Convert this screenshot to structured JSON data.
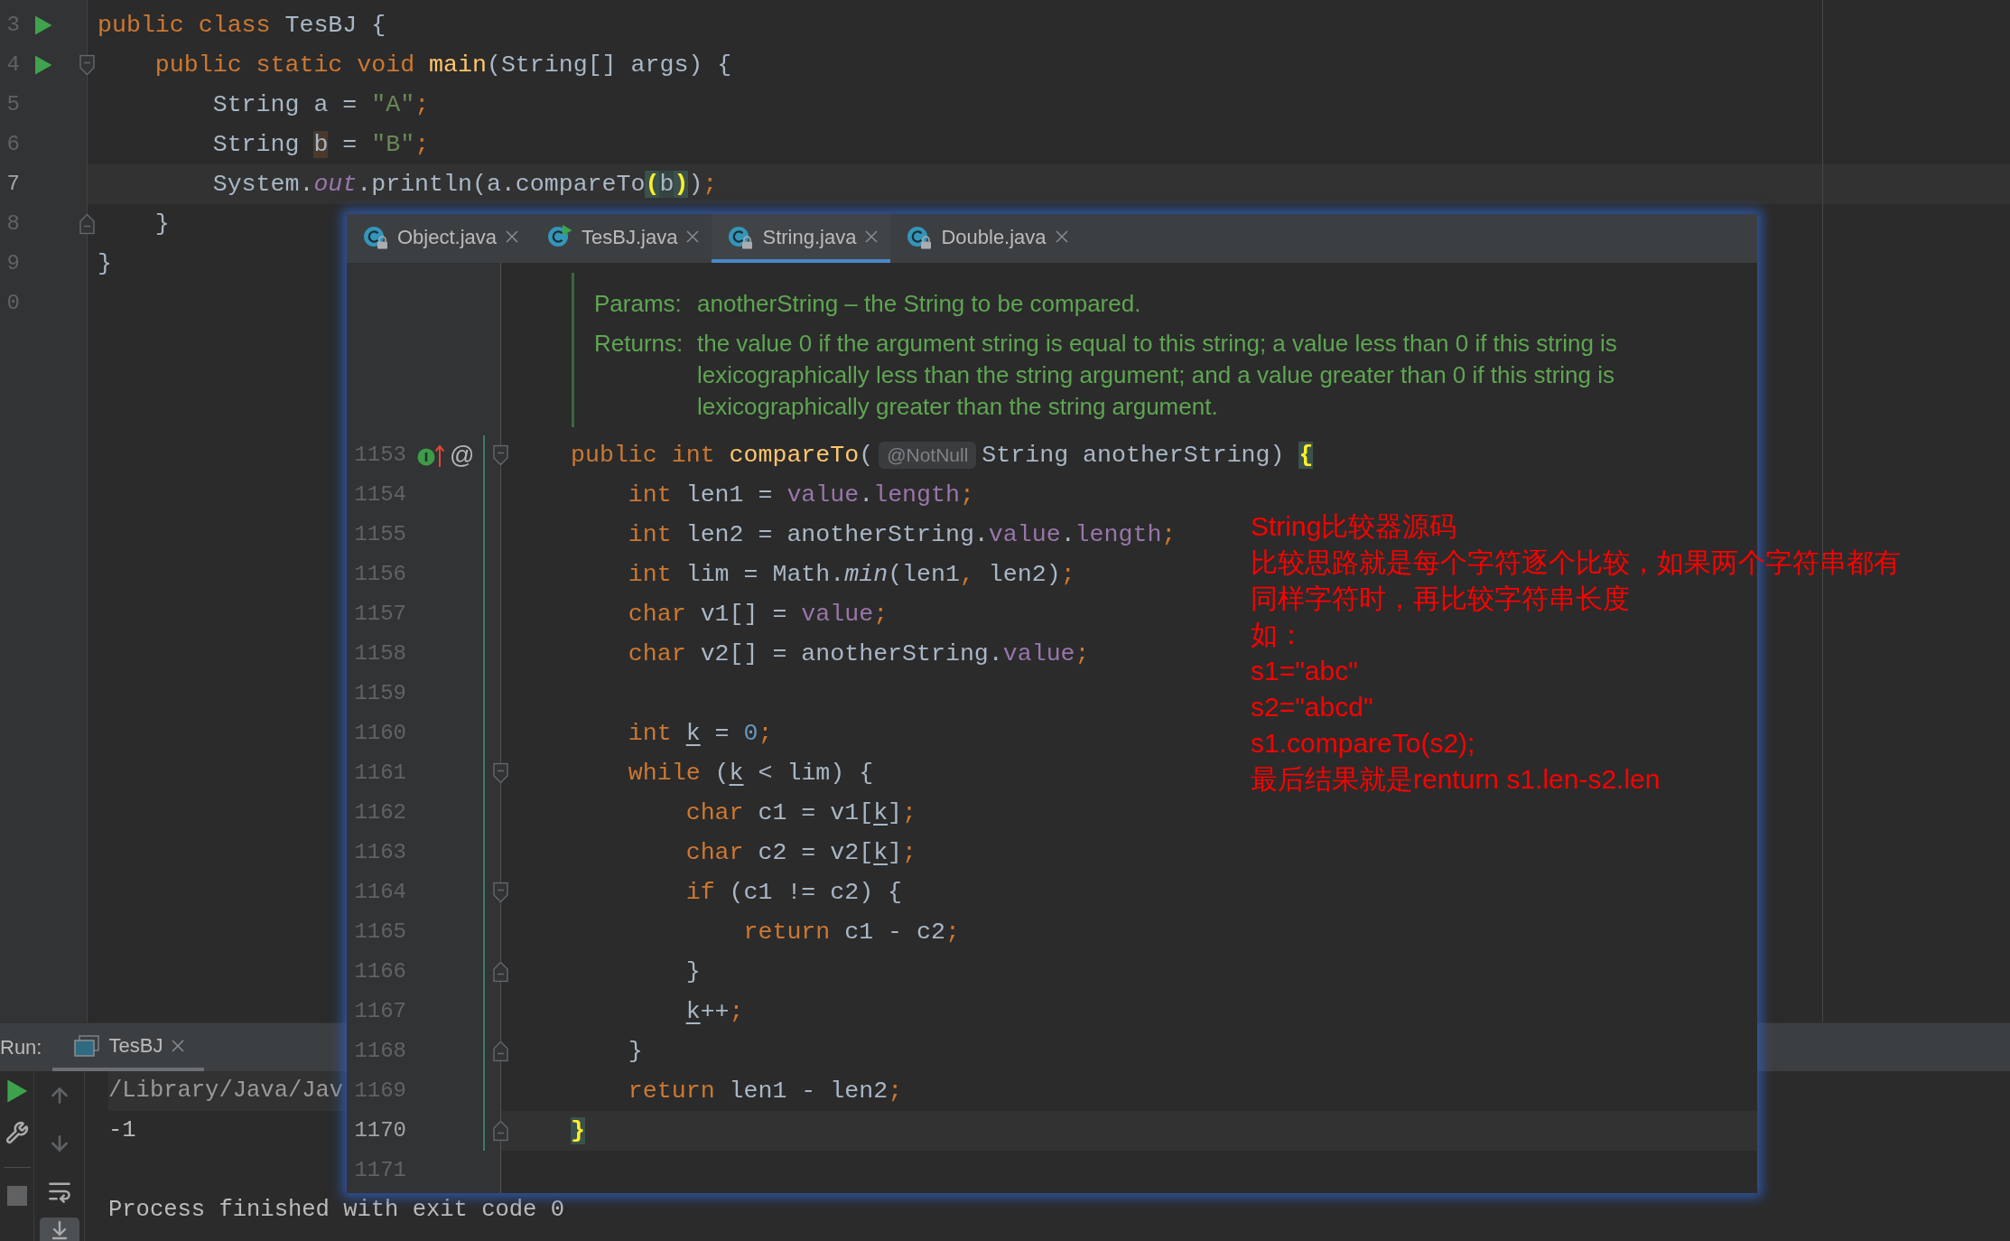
{
  "editor": {
    "lines": [
      {
        "number": "3",
        "run_marker": true,
        "current": false,
        "fold_start": false,
        "fold_end": false,
        "tokens": [
          {
            "text": "public ",
            "kind": "keyword"
          },
          {
            "text": "class ",
            "kind": "keyword"
          },
          {
            "text": "TesBJ {",
            "kind": "plain"
          }
        ]
      },
      {
        "number": "4",
        "run_marker": true,
        "current": false,
        "fold_start": true,
        "fold_end": false,
        "tokens": [
          {
            "text": "    public ",
            "kind": "keyword"
          },
          {
            "text": "static ",
            "kind": "keyword"
          },
          {
            "text": "void ",
            "kind": "keyword"
          },
          {
            "text": "main",
            "kind": "method_decl"
          },
          {
            "text": "(String[] args) {",
            "kind": "plain"
          }
        ]
      },
      {
        "number": "5",
        "run_marker": false,
        "current": false,
        "fold_start": false,
        "fold_end": false,
        "tokens": [
          {
            "text": "        String a = ",
            "kind": "plain"
          },
          {
            "text": "\"A\"",
            "kind": "string"
          },
          {
            "text": ";",
            "kind": "punct"
          }
        ]
      },
      {
        "number": "6",
        "run_marker": false,
        "current": false,
        "fold_start": false,
        "fold_end": false,
        "tokens": [
          {
            "text": "        String ",
            "kind": "plain"
          },
          {
            "text": "b",
            "kind": "write_usage"
          },
          {
            "text": " = ",
            "kind": "plain"
          },
          {
            "text": "\"B\"",
            "kind": "string"
          },
          {
            "text": ";",
            "kind": "punct"
          }
        ]
      },
      {
        "number": "7",
        "run_marker": false,
        "current": true,
        "fold_start": false,
        "fold_end": false,
        "tokens": [
          {
            "text": "        System.",
            "kind": "plain"
          },
          {
            "text": "out",
            "kind": "static_field"
          },
          {
            "text": ".println(a.compareTo",
            "kind": "plain"
          },
          {
            "text": "(",
            "kind": "brace_match"
          },
          {
            "text": "b",
            "kind": "match_range"
          },
          {
            "text": ")",
            "kind": "brace_match"
          },
          {
            "text": ")",
            "kind": "plain"
          },
          {
            "text": ";",
            "kind": "punct"
          }
        ]
      },
      {
        "number": "8",
        "run_marker": false,
        "current": false,
        "fold_start": false,
        "fold_end": true,
        "tokens": [
          {
            "text": "    }",
            "kind": "plain"
          }
        ]
      },
      {
        "number": "9",
        "run_marker": false,
        "current": false,
        "fold_start": false,
        "fold_end": false,
        "tokens": [
          {
            "text": "}",
            "kind": "plain"
          }
        ]
      },
      {
        "number": "0",
        "run_marker": false,
        "current": false,
        "fold_start": false,
        "fold_end": false
      }
    ]
  },
  "popup": {
    "tabs": [
      {
        "label": "Object.java",
        "kind": "library",
        "selected": false
      },
      {
        "label": "TesBJ.java",
        "kind": "runnable",
        "selected": false
      },
      {
        "label": "String.java",
        "kind": "library",
        "selected": true
      },
      {
        "label": "Double.java",
        "kind": "library",
        "selected": false
      }
    ],
    "doc": {
      "params_label": "Params:",
      "params_text": "anotherString – the String to be compared.",
      "returns_label": "Returns:",
      "returns_text": "the value 0 if the argument string is equal to this string; a value less than 0 if this string is lexicographically less than the string argument; and a value greater than 0 if this string is lexicographically greater than the string argument."
    },
    "lines": [
      {
        "number": "1153",
        "changed": true,
        "current": false,
        "fold_start": true,
        "fold_end": false,
        "method_marker": true,
        "gutter_text": "@",
        "tokens": [
          {
            "text": "public ",
            "kind": "keyword"
          },
          {
            "text": "int ",
            "kind": "keyword"
          },
          {
            "text": "compareTo",
            "kind": "method_decl"
          },
          {
            "text": "(",
            "kind": "plain"
          },
          {
            "text": "@NotNull",
            "kind": "inlay_hint"
          },
          {
            "text": "String anotherString) ",
            "kind": "plain"
          },
          {
            "text": "{",
            "kind": "brace_match"
          }
        ]
      },
      {
        "number": "1154",
        "changed": true,
        "current": false,
        "fold_start": false,
        "fold_end": false,
        "method_marker": false,
        "tokens": [
          {
            "text": "    int ",
            "kind": "keyword"
          },
          {
            "text": "len1 = ",
            "kind": "plain"
          },
          {
            "text": "value",
            "kind": "field"
          },
          {
            "text": ".",
            "kind": "plain"
          },
          {
            "text": "length",
            "kind": "field"
          },
          {
            "text": ";",
            "kind": "punct"
          }
        ]
      },
      {
        "number": "1155",
        "changed": true,
        "current": false,
        "fold_start": false,
        "fold_end": false,
        "method_marker": false,
        "tokens": [
          {
            "text": "    int ",
            "kind": "keyword"
          },
          {
            "text": "len2 = anotherString.",
            "kind": "plain"
          },
          {
            "text": "value",
            "kind": "field"
          },
          {
            "text": ".",
            "kind": "plain"
          },
          {
            "text": "length",
            "kind": "field"
          },
          {
            "text": ";",
            "kind": "punct"
          }
        ]
      },
      {
        "number": "1156",
        "changed": true,
        "current": false,
        "fold_start": false,
        "fold_end": false,
        "method_marker": false,
        "tokens": [
          {
            "text": "    int ",
            "kind": "keyword"
          },
          {
            "text": "lim = Math.",
            "kind": "plain"
          },
          {
            "text": "min",
            "kind": "static_method"
          },
          {
            "text": "(len1",
            "kind": "plain"
          },
          {
            "text": ",",
            "kind": "punct"
          },
          {
            "text": " len2)",
            "kind": "plain"
          },
          {
            "text": ";",
            "kind": "punct"
          }
        ]
      },
      {
        "number": "1157",
        "changed": true,
        "current": false,
        "fold_start": false,
        "fold_end": false,
        "method_marker": false,
        "tokens": [
          {
            "text": "    char ",
            "kind": "keyword"
          },
          {
            "text": "v1[] = ",
            "kind": "plain"
          },
          {
            "text": "value",
            "kind": "field"
          },
          {
            "text": ";",
            "kind": "punct"
          }
        ]
      },
      {
        "number": "1158",
        "changed": true,
        "current": false,
        "fold_start": false,
        "fold_end": false,
        "method_marker": false,
        "tokens": [
          {
            "text": "    char ",
            "kind": "keyword"
          },
          {
            "text": "v2[] = anotherString.",
            "kind": "plain"
          },
          {
            "text": "value",
            "kind": "field"
          },
          {
            "text": ";",
            "kind": "punct"
          }
        ]
      },
      {
        "number": "1159",
        "changed": true,
        "current": false,
        "fold_start": false,
        "fold_end": false,
        "method_marker": false
      },
      {
        "number": "1160",
        "changed": true,
        "current": false,
        "fold_start": false,
        "fold_end": false,
        "method_marker": false,
        "tokens": [
          {
            "text": "    int ",
            "kind": "keyword"
          },
          {
            "text": "k",
            "kind": "local_mut"
          },
          {
            "text": " = ",
            "kind": "plain"
          },
          {
            "text": "0",
            "kind": "number"
          },
          {
            "text": ";",
            "kind": "punct"
          }
        ]
      },
      {
        "number": "1161",
        "changed": true,
        "current": false,
        "fold_start": true,
        "fold_end": false,
        "method_marker": false,
        "tokens": [
          {
            "text": "    while ",
            "kind": "keyword"
          },
          {
            "text": "(",
            "kind": "plain"
          },
          {
            "text": "k",
            "kind": "local_mut"
          },
          {
            "text": " < lim) {",
            "kind": "plain"
          }
        ]
      },
      {
        "number": "1162",
        "changed": true,
        "current": false,
        "fold_start": false,
        "fold_end": false,
        "method_marker": false,
        "tokens": [
          {
            "text": "        char ",
            "kind": "keyword"
          },
          {
            "text": "c1 = v1[",
            "kind": "plain"
          },
          {
            "text": "k",
            "kind": "local_mut"
          },
          {
            "text": "]",
            "kind": "plain"
          },
          {
            "text": ";",
            "kind": "punct"
          }
        ]
      },
      {
        "number": "1163",
        "changed": true,
        "current": false,
        "fold_start": false,
        "fold_end": false,
        "method_marker": false,
        "tokens": [
          {
            "text": "        char ",
            "kind": "keyword"
          },
          {
            "text": "c2 = v2[",
            "kind": "plain"
          },
          {
            "text": "k",
            "kind": "local_mut"
          },
          {
            "text": "]",
            "kind": "plain"
          },
          {
            "text": ";",
            "kind": "punct"
          }
        ]
      },
      {
        "number": "1164",
        "changed": true,
        "current": false,
        "fold_start": true,
        "fold_end": false,
        "method_marker": false,
        "tokens": [
          {
            "text": "        if ",
            "kind": "keyword"
          },
          {
            "text": "(c1 != c2) {",
            "kind": "plain"
          }
        ]
      },
      {
        "number": "1165",
        "changed": true,
        "current": false,
        "fold_start": false,
        "fold_end": false,
        "method_marker": false,
        "tokens": [
          {
            "text": "            return ",
            "kind": "keyword"
          },
          {
            "text": "c1 - c2",
            "kind": "plain"
          },
          {
            "text": ";",
            "kind": "punct"
          }
        ]
      },
      {
        "number": "1166",
        "changed": true,
        "current": false,
        "fold_start": false,
        "fold_end": true,
        "method_marker": false,
        "tokens": [
          {
            "text": "        }",
            "kind": "plain"
          }
        ]
      },
      {
        "number": "1167",
        "changed": true,
        "current": false,
        "fold_start": false,
        "fold_end": false,
        "method_marker": false,
        "tokens": [
          {
            "text": "        k",
            "kind": "local_mut"
          },
          {
            "text": "++",
            "kind": "plain"
          },
          {
            "text": ";",
            "kind": "punct"
          }
        ]
      },
      {
        "number": "1168",
        "changed": true,
        "current": false,
        "fold_start": false,
        "fold_end": true,
        "method_marker": false,
        "tokens": [
          {
            "text": "    }",
            "kind": "plain"
          }
        ]
      },
      {
        "number": "1169",
        "changed": true,
        "current": false,
        "fold_start": false,
        "fold_end": false,
        "method_marker": false,
        "tokens": [
          {
            "text": "    return ",
            "kind": "keyword"
          },
          {
            "text": "len1 - len2",
            "kind": "plain"
          },
          {
            "text": ";",
            "kind": "punct"
          }
        ]
      },
      {
        "number": "1170",
        "changed": true,
        "current": true,
        "fold_start": false,
        "fold_end": true,
        "method_marker": false,
        "tokens": [
          {
            "text": "}",
            "kind": "brace_match"
          }
        ]
      },
      {
        "number": "1171",
        "changed": false,
        "current": false,
        "fold_start": false,
        "fold_end": false,
        "method_marker": false
      }
    ]
  },
  "annotation": {
    "lines": [
      "String比较器源码",
      "比较思路就是每个字符逐个比较，如果两个字符串都有同样字符时，再比较字符串长度",
      "如：",
      "s1=\"abc\"",
      "s2=\"abcd\"",
      "s1.compareTo(s2);",
      "最后结果就是renturn s1.len-s2.len"
    ]
  },
  "run_panel": {
    "label": "Run:",
    "tabs": [
      {
        "label": "TesBJ",
        "selected": true
      }
    ],
    "toolbar": {
      "scroll_to_end": true
    },
    "console": [
      {
        "text": "/Library/Java/Jav",
        "kind": "command"
      },
      {
        "text": "-1",
        "kind": "output"
      },
      {
        "text": "Process finished with exit code 0",
        "kind": "system"
      }
    ]
  }
}
